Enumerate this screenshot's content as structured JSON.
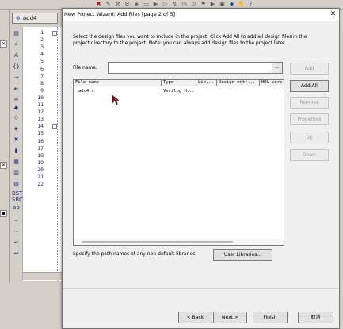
{
  "ide": {
    "tab_label": "add4",
    "line_numbers": [
      "1",
      "2",
      "3",
      "4",
      "5",
      "6",
      "7",
      "8",
      "9",
      "10",
      "11",
      "12",
      "13",
      "14",
      "15",
      "16",
      "17",
      "18",
      "19",
      "20",
      "21",
      "22"
    ],
    "strip_marks": [
      "x",
      "x",
      "m"
    ],
    "left_texts": [
      "BST",
      "SRC"
    ]
  },
  "dialog": {
    "title": "New Project Wizard: Add Files [page 2 of 5]",
    "close_glyph": "✕",
    "instruction": "Select the design files you want to include in the project. Click Add All to add all design files in the project directory to the project. Note: you can always add design files to the project later.",
    "file_name_label": "File name:",
    "file_name_value": "",
    "browse_label": "...",
    "side_buttons": {
      "add": "Add",
      "add_all": "Add All",
      "remove": "Remove",
      "properties": "Properties",
      "up": "Up",
      "down": "Down"
    },
    "table": {
      "columns": [
        "File name",
        "Type",
        "Lib...",
        "Design entr...",
        "HDL vers"
      ],
      "rows": [
        [
          "add4.v",
          "Verilog H...",
          "",
          "",
          ""
        ]
      ]
    },
    "path_text": "Specify the path names of any non-default libraries.",
    "user_libraries": "User Libraries...",
    "footer": {
      "back": "< Back",
      "next": "Next >",
      "finish": "Finish",
      "cancel": "取消"
    }
  },
  "colors": {
    "dialog_bg": "#f0f0f0",
    "ide_bg": "#d4d0c8",
    "line_number_color": "#103080"
  }
}
